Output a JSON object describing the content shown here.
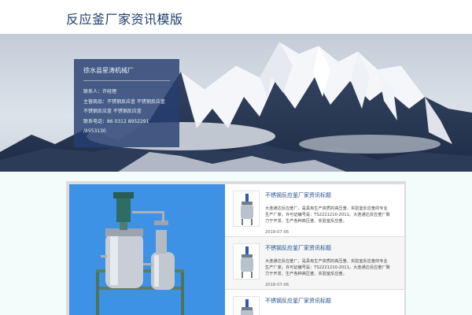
{
  "header": {
    "title": "反应釜厂家资讯模版"
  },
  "company": {
    "name": "徐水县星涛机械厂",
    "contact": "联系人：许经理",
    "products_line1": "主营商品：不锈钢反应釜 不锈钢反应釜",
    "products_line2": "不锈钢反应釜 不锈钢反应釜",
    "phone_line1": "联系电话：86 0312 8952291",
    "phone_line2": "/8953130"
  },
  "news": [
    {
      "title": "不锈钢反应釜厂家资讯标题",
      "desc": "大连通达反应釜厂，是具有生产资质的高压釜、实验室反应釜的专业生产厂家。许可证编号是：TS2221210-2011。大连通达反应釜厂致力于开发、生产各种高压釜、实验室反应釜。",
      "date": "2018-07-06"
    },
    {
      "title": "不锈钢反应釜厂家资讯标题",
      "desc": "大连通达反应釜厂，是具有生产资质的高压釜、实验室反应釜的专业生产厂家。许可证编号是：TS2221210-2011。大连通达反应釜厂致力于开发、生产各种高压釜、实验室反应釜。",
      "date": "2018-07-06"
    },
    {
      "title": "不锈钢反应釜厂家资讯标题",
      "desc": "",
      "date": ""
    }
  ],
  "colors": {
    "accent": "#1e3f6e",
    "card_bg": "#263e70",
    "feature_bg": "#3e92e6",
    "title_blue": "#1f4d86"
  },
  "icons": {
    "banner": "snowy-mountain-image",
    "feature": "reactor-vessel-image",
    "thumb": "reactor-thumbnail-image"
  }
}
